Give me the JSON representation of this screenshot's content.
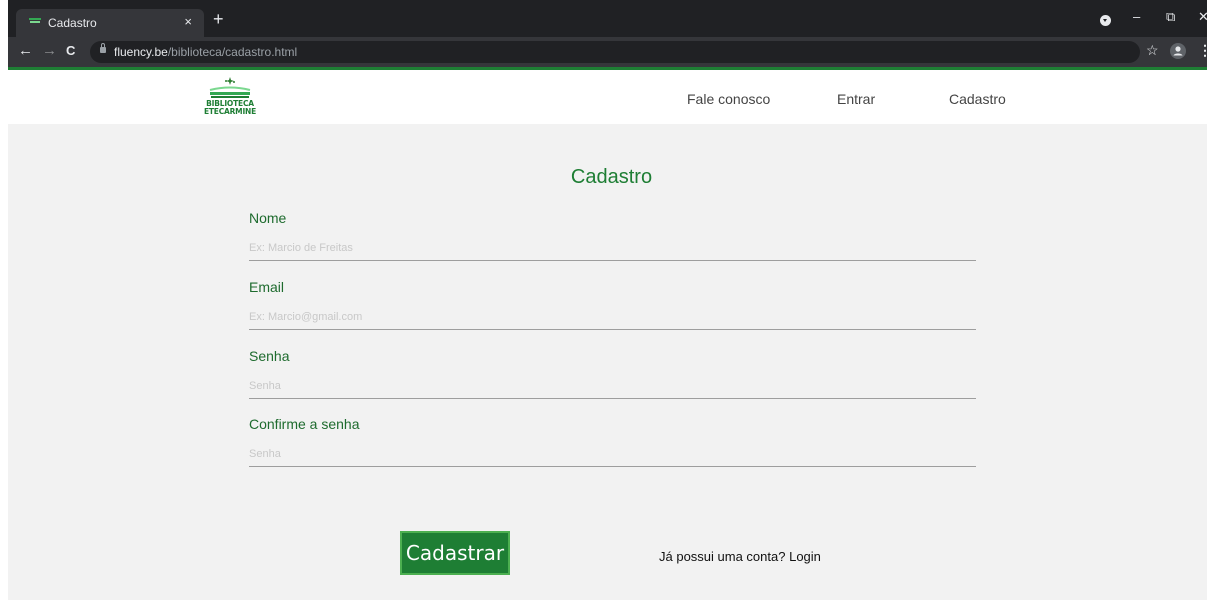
{
  "browser": {
    "tab_title": "Cadastro",
    "tab_close": "×",
    "new_tab": "+",
    "url_host": "fluency.be",
    "url_path": "/biblioteca/cadastro.html",
    "minimize": "–",
    "restore": "⧉",
    "close": "✕",
    "back": "←",
    "forward": "→",
    "reload": "C",
    "bookmark": "☆",
    "menu": "⋮"
  },
  "header": {
    "logo_line1": "BIBLIOTECA",
    "logo_line2": "ETECARMINE",
    "nav": {
      "contact": "Fale conosco",
      "login": "Entrar",
      "register": "Cadastro"
    }
  },
  "form": {
    "title": "Cadastro",
    "fields": [
      {
        "label": "Nome",
        "value": "",
        "placeholder": "Ex: Marcio de Freitas"
      },
      {
        "label": "Email",
        "value": "",
        "placeholder": "Ex: Marcio@gmail.com"
      },
      {
        "label": "Senha",
        "value": "",
        "placeholder": "Senha"
      },
      {
        "label": "Confirme a senha",
        "value": "",
        "placeholder": "Senha"
      }
    ],
    "submit_label": "Cadastrar",
    "login_prompt": "Já possui uma conta?",
    "login_link": "Login"
  },
  "colors": {
    "brand_green": "#1e7e34",
    "label_green": "#1e6b2e",
    "chrome_dark": "#202124",
    "content_bg": "#f2f2f2"
  }
}
